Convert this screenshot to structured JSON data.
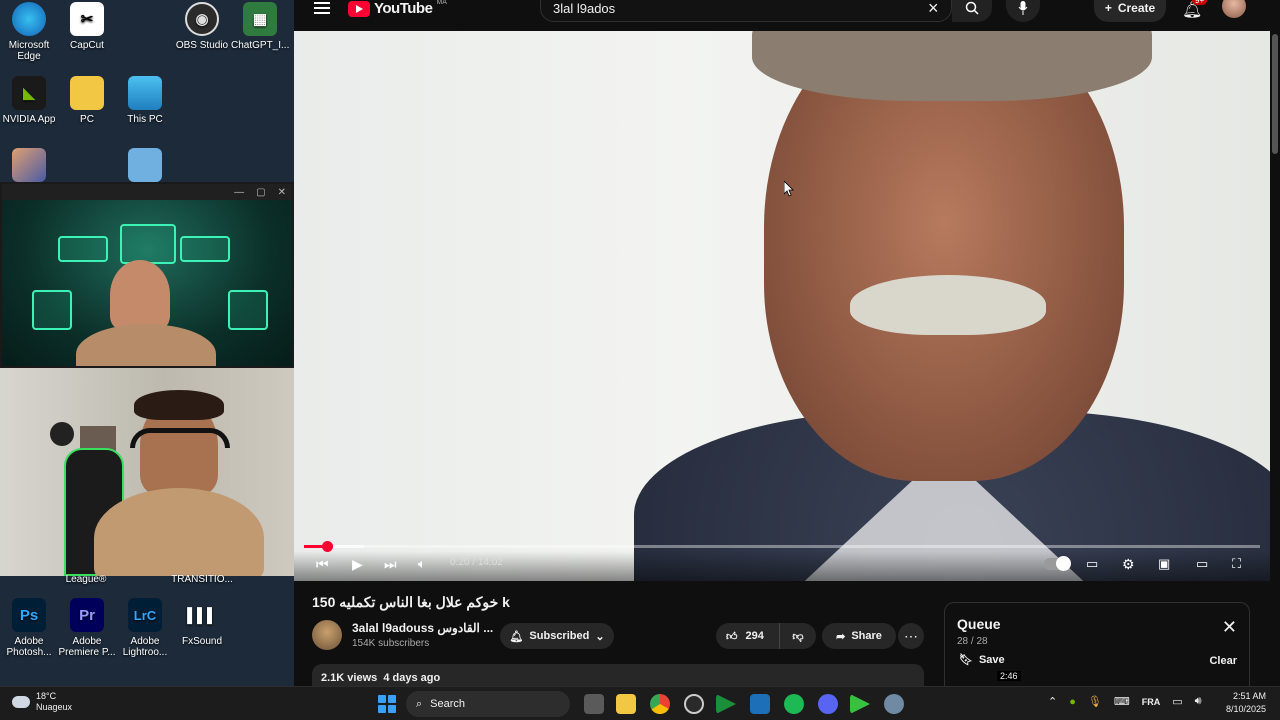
{
  "desktop": {
    "icons": [
      {
        "label": "Microsoft Edge",
        "glyph": "e",
        "color": "#1e8fd6"
      },
      {
        "label": "CapCut",
        "glyph": "✂",
        "color": "#ffffff"
      },
      {
        "label": "OBS Studio",
        "glyph": "◉",
        "color": "#3a3a3a"
      },
      {
        "label": "ChatGPT_I...",
        "glyph": "▦",
        "color": "#2f7b3f"
      },
      {
        "label": "NVIDIA App",
        "glyph": "◣",
        "color": "#76b900"
      },
      {
        "label": "PC",
        "glyph": "",
        "color": "#f2c744"
      },
      {
        "label": "This PC",
        "glyph": "",
        "color": "#3fa0d8"
      },
      {
        "label": "",
        "glyph": "",
        "color": "#5a6fb5"
      },
      {
        "label": "",
        "glyph": "",
        "color": "#6fb0e0"
      },
      {
        "label": "League®",
        "glyph": "",
        "color": "#1a1a1a"
      },
      {
        "label": "TRANSITIO...",
        "glyph": "",
        "color": "#1a1a1a"
      },
      {
        "label": "Adobe Photosh...",
        "glyph": "Ps",
        "color": "#0a2236"
      },
      {
        "label": "Adobe Premiere P...",
        "glyph": "Pr",
        "color": "#1f0a3a"
      },
      {
        "label": "Adobe Lightroo...",
        "glyph": "LrC",
        "color": "#0a2236"
      },
      {
        "label": "FxSound",
        "glyph": "▌▌▌",
        "color": "#2a2a2a"
      }
    ]
  },
  "youtube": {
    "logo_text": "YouTube",
    "logo_region": "MA",
    "search_value": "3lal l9ados",
    "create_label": "Create",
    "notifications_badge": "9+",
    "player": {
      "time_current": "0:20",
      "time_separator": " / ",
      "time_total": "14:02",
      "progress_fraction": 0.024,
      "buffer_fraction": 0.063
    },
    "video": {
      "title": "150 خوكم علال بغا الناس تكمليه k",
      "channel_name": "3alal l9adouss القادوس ...",
      "subscribers": "154K subscribers",
      "subscribed_label": "Subscribed",
      "likes": "294",
      "share_label": "Share",
      "views_meta": "2.1K views  4 days ago"
    },
    "queue": {
      "title": "Queue",
      "count": "28 / 28",
      "save_label": "Save",
      "clear_label": "Clear",
      "item_duration": "2:46"
    }
  },
  "taskbar": {
    "weather_temp": "18°C",
    "weather_desc": "Nuageux",
    "search_placeholder": "Search",
    "language": "FRA",
    "time": "2:51 AM",
    "date": "8/10/2025"
  },
  "colors": {
    "accent_red": "#ff0033",
    "yt_bg": "#0f0f0f",
    "chip_bg": "#272727"
  }
}
